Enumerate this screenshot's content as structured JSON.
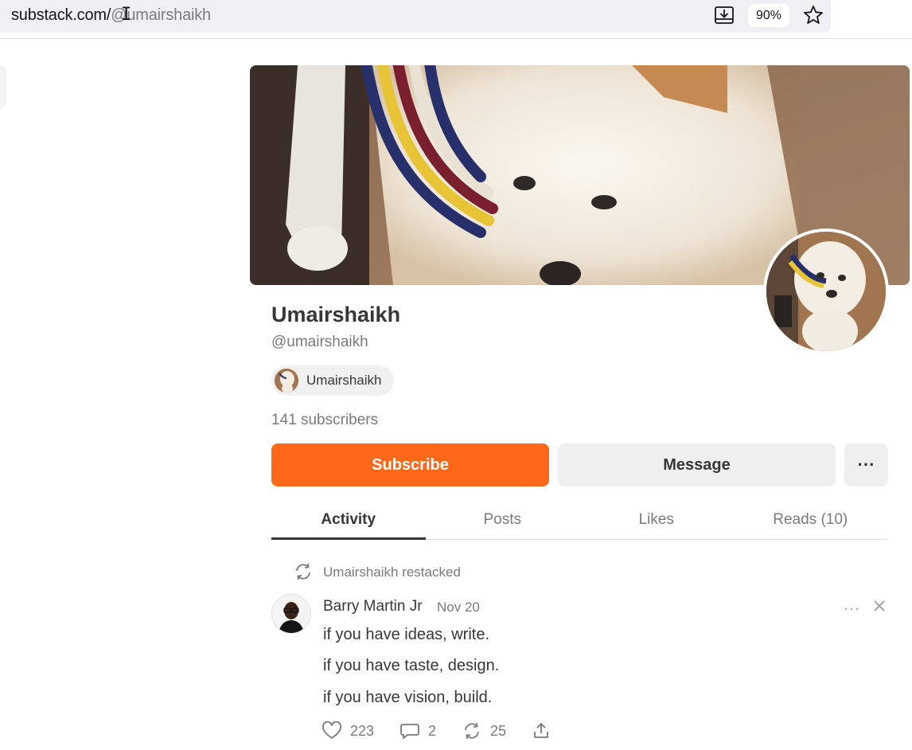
{
  "browser": {
    "url_host": "substack.com/",
    "url_path": "@umairshaikh",
    "zoom": "90%",
    "icons": [
      "download-icon",
      "bookmark-star-icon"
    ]
  },
  "profile": {
    "name": "Umairshaikh",
    "handle": "@umairshaikh",
    "publication": "Umairshaikh",
    "subscribers": "141 subscribers",
    "buttons": {
      "subscribe": "Subscribe",
      "message": "Message",
      "more": "···"
    },
    "accent_color": "#ff6719"
  },
  "tabs": [
    {
      "label": "Activity",
      "active": true
    },
    {
      "label": "Posts",
      "active": false
    },
    {
      "label": "Likes",
      "active": false
    },
    {
      "label": "Reads (10)",
      "active": false
    }
  ],
  "feed": {
    "restack_label": "Umairshaikh restacked",
    "author": "Barry Martin Jr",
    "date": "Nov 20",
    "lines": [
      "if you have ideas, write.",
      "if you have taste, design.",
      "if you have vision, build."
    ],
    "likes": "223",
    "comments": "2",
    "restacks": "25"
  }
}
